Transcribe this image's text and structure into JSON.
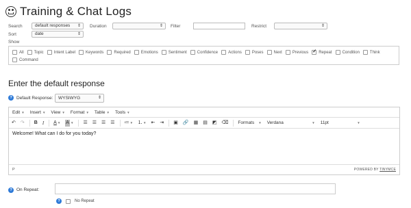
{
  "page": {
    "title": "Training & Chat Logs",
    "title_icon": "chat-face-icon"
  },
  "filters": {
    "search_label": "Search",
    "search_value": "default responses",
    "duration_label": "Duration",
    "duration_value": "",
    "filter_label": "Filter",
    "filter_value": "",
    "restrict_label": "Restrict",
    "restrict_value": "",
    "sort_label": "Sort",
    "sort_value": "date",
    "show_label": "Show"
  },
  "show_options": [
    {
      "label": "All",
      "checked": false
    },
    {
      "label": "Topic",
      "checked": false
    },
    {
      "label": "Intent Label",
      "checked": false
    },
    {
      "label": "Keywords",
      "checked": false
    },
    {
      "label": "Required",
      "checked": false
    },
    {
      "label": "Emotions",
      "checked": false
    },
    {
      "label": "Sentiment",
      "checked": false
    },
    {
      "label": "Confidence",
      "checked": false
    },
    {
      "label": "Actions",
      "checked": false
    },
    {
      "label": "Poses",
      "checked": false
    },
    {
      "label": "Next",
      "checked": false
    },
    {
      "label": "Previous",
      "checked": false
    },
    {
      "label": "Repeat",
      "checked": true
    },
    {
      "label": "Condition",
      "checked": false
    },
    {
      "label": "Think",
      "checked": false
    },
    {
      "label": "Command",
      "checked": false
    }
  ],
  "section": {
    "title": "Enter the default response"
  },
  "default_response": {
    "label": "Default Response:",
    "value": "WYSIWYG",
    "info": "?"
  },
  "editor": {
    "menus": [
      "Edit",
      "Insert",
      "View",
      "Format",
      "Table",
      "Tools"
    ],
    "format_dropdown": "Formats",
    "font_dropdown": "Verdana",
    "size_dropdown": "11pt",
    "content": "Welcome! What can I do for you today?",
    "status_path": "P",
    "powered_by": "POWERED BY ",
    "brand": "TINYMCE"
  },
  "on_repeat": {
    "label": "On Repeat:",
    "value": "",
    "info": "?"
  },
  "no_repeat": {
    "label": "No Repeat",
    "checked": false,
    "info": "?"
  }
}
